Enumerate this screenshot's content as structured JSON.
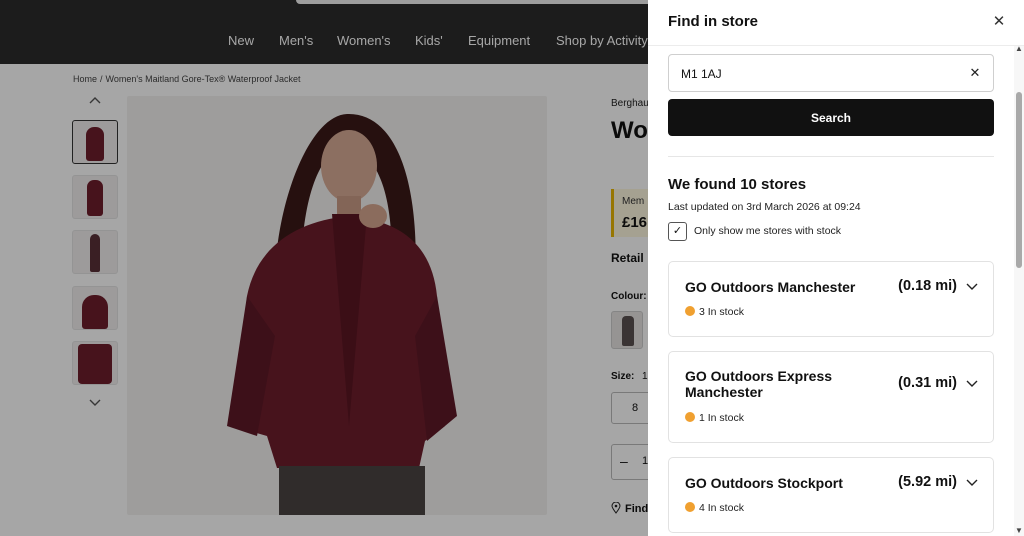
{
  "nav": {
    "items": [
      "New",
      "Men's",
      "Women's",
      "Kids'",
      "Equipment",
      "Shop by Activity"
    ]
  },
  "breadcrumb": {
    "home": "Home",
    "separator": "/",
    "current": "Women's Maitland Gore-Tex® Waterproof Jacket"
  },
  "product": {
    "brand": "Berghaus",
    "title_fragment": "Wo Tex",
    "member_label": "Mem",
    "member_price": "£16",
    "retail_label": "Retail",
    "colour_label": "Colour:",
    "size_label": "Size:",
    "size_value": "1",
    "size_option": "8",
    "qty_minus": "–",
    "qty_value": "1",
    "find_label": "Find"
  },
  "drawer": {
    "title": "Find in store",
    "close_icon": "close-icon",
    "search_value": "M1 1AJ",
    "clear_icon": "clear-icon",
    "search_button": "Search",
    "results_heading": "We found 10 stores",
    "last_updated": "Last updated on 3rd March 2026 at 09:24",
    "only_stock_label": "Only show me stores with stock",
    "only_stock_checked": true,
    "stock_dot_color": "#f0a030",
    "stores": [
      {
        "name": "GO Outdoors Manchester",
        "distance": "(0.18 mi)",
        "stock": "3 In stock"
      },
      {
        "name": "GO Outdoors Express Manchester",
        "distance": "(0.31 mi)",
        "stock": "1 In stock"
      },
      {
        "name": "GO Outdoors Stockport",
        "distance": "(5.92 mi)",
        "stock": "4 In stock"
      }
    ]
  },
  "colors": {
    "header_bg": "#2b2b2b",
    "button_bg": "#111111",
    "jacket": "#6e1e2c",
    "member_accent": "#e9b500"
  }
}
